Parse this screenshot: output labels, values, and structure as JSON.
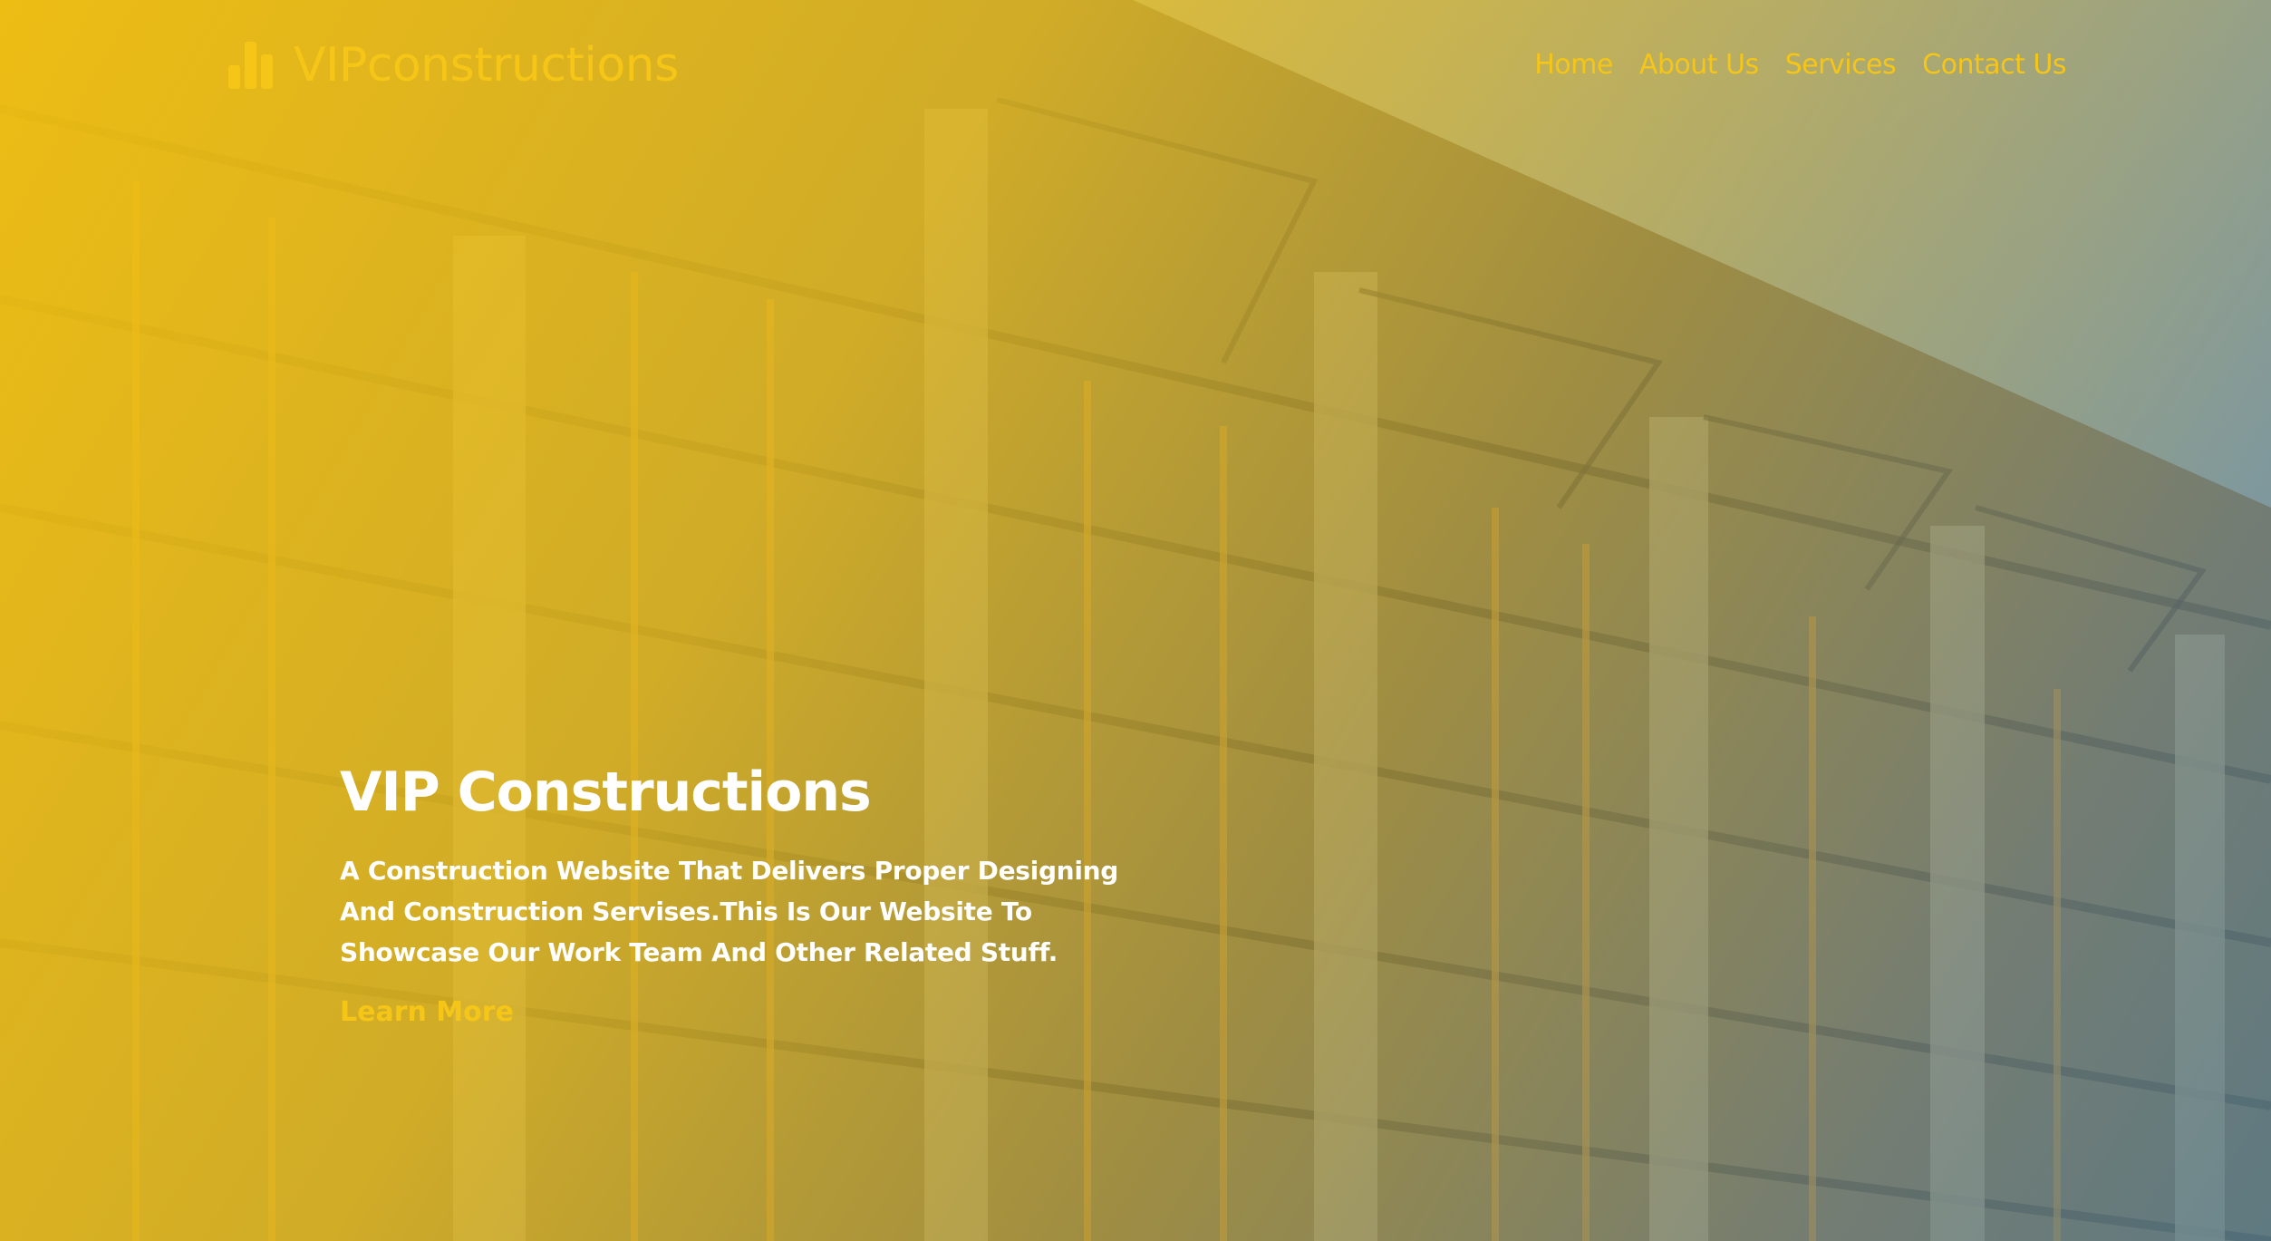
{
  "brand": {
    "name": "VIPconstructions",
    "icon": "bar-chart-icon",
    "color": "#f5c518"
  },
  "nav": {
    "items": [
      {
        "label": "Home"
      },
      {
        "label": "About Us"
      },
      {
        "label": "Services"
      },
      {
        "label": "Contact Us"
      }
    ]
  },
  "hero": {
    "title": "VIP Constructions",
    "subtitle": "A Construction Website That Delivers Proper Designing And Construction Servises.This Is Our Website To Showcase Our Work Team And Other Related Stuff.",
    "cta_label": "Learn More",
    "background_image": "construction-site-scaffolding",
    "overlay_colors": [
      "#f7c410",
      "#5082a0"
    ]
  }
}
